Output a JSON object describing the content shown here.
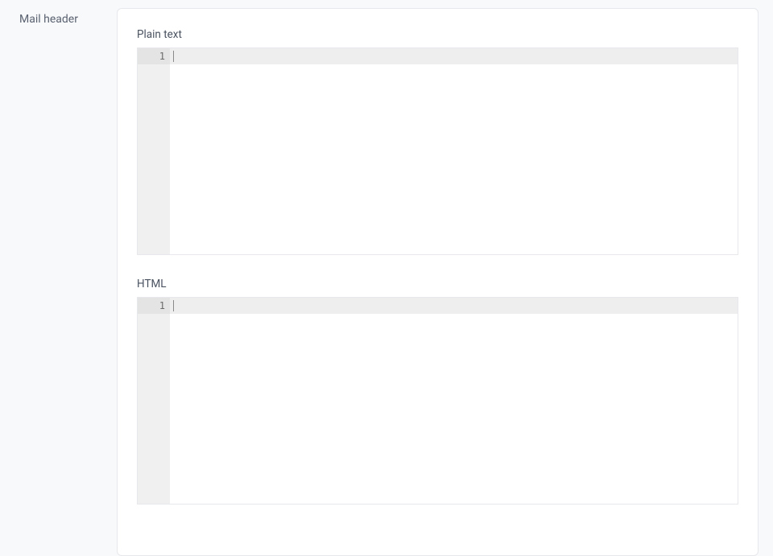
{
  "sidebar": {
    "section_title": "Mail header"
  },
  "editors": {
    "plain": {
      "label": "Plain text",
      "first_line_number": "1",
      "content": ""
    },
    "html": {
      "label": "HTML",
      "first_line_number": "1",
      "content": ""
    }
  }
}
